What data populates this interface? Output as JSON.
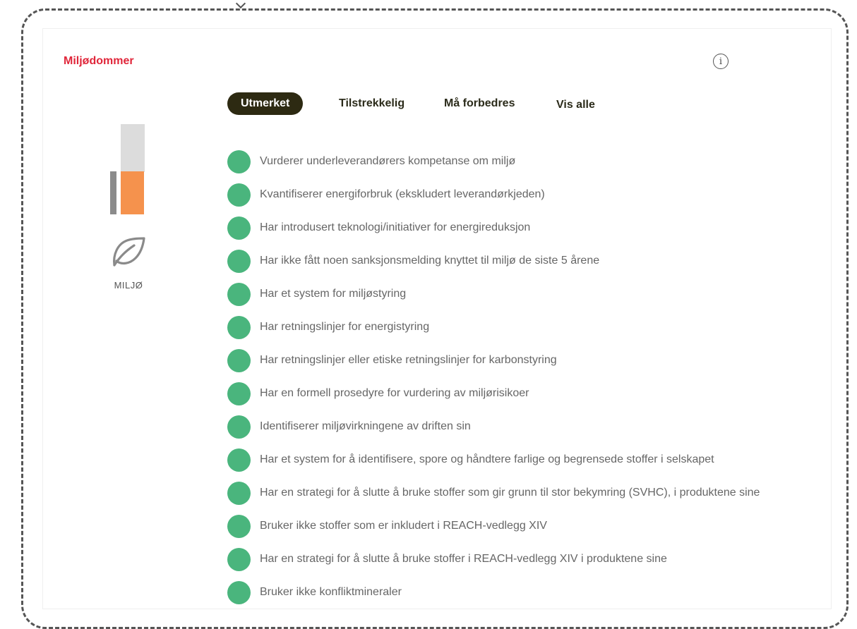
{
  "section": {
    "title": "Miljødommer",
    "info_icon": "info-icon"
  },
  "tabs": [
    {
      "label": "Utmerket",
      "active": true
    },
    {
      "label": "Tilstrekkelig",
      "active": false
    },
    {
      "label": "Må forbedres",
      "active": false
    },
    {
      "label": "Vis alle",
      "active": false
    }
  ],
  "category": {
    "label": "MILJØ",
    "icon": "leaf-icon"
  },
  "colors": {
    "title_red": "#e0263a",
    "tab_active_bg": "#2d2a12",
    "status_green": "#4ab57d",
    "score_orange": "#f5924d",
    "score_gray": "#dcdcdc"
  },
  "criteria": [
    {
      "status": "excellent",
      "text": "Vurderer underleverandørers kompetanse om miljø"
    },
    {
      "status": "excellent",
      "text": "Kvantifiserer energiforbruk (ekskludert leverandørkjeden)"
    },
    {
      "status": "excellent",
      "text": "Har introdusert teknologi/initiativer for energireduksjon"
    },
    {
      "status": "excellent",
      "text": "Har ikke fått noen sanksjonsmelding knyttet til miljø de siste 5 årene"
    },
    {
      "status": "excellent",
      "text": "Har et system for miljøstyring"
    },
    {
      "status": "excellent",
      "text": "Har retningslinjer for energistyring"
    },
    {
      "status": "excellent",
      "text": "Har retningslinjer eller etiske retningslinjer for karbonstyring"
    },
    {
      "status": "excellent",
      "text": "Har en formell prosedyre for vurdering av miljørisikoer"
    },
    {
      "status": "excellent",
      "text": "Identifiserer miljøvirkningene av driften sin"
    },
    {
      "status": "excellent",
      "text": "Har et system for å identifisere, spore og håndtere farlige og begrensede stoffer i selskapet"
    },
    {
      "status": "excellent",
      "text": "Har en strategi for å slutte å bruke stoffer som gir grunn til stor bekymring (SVHC), i produktene sine"
    },
    {
      "status": "excellent",
      "text": "Bruker ikke stoffer som er inkludert i REACH-vedlegg XIV"
    },
    {
      "status": "excellent",
      "text": "Har en strategi for å slutte å bruke stoffer i REACH-vedlegg XIV i produktene sine"
    },
    {
      "status": "excellent",
      "text": "Bruker ikke konfliktmineraler"
    }
  ]
}
